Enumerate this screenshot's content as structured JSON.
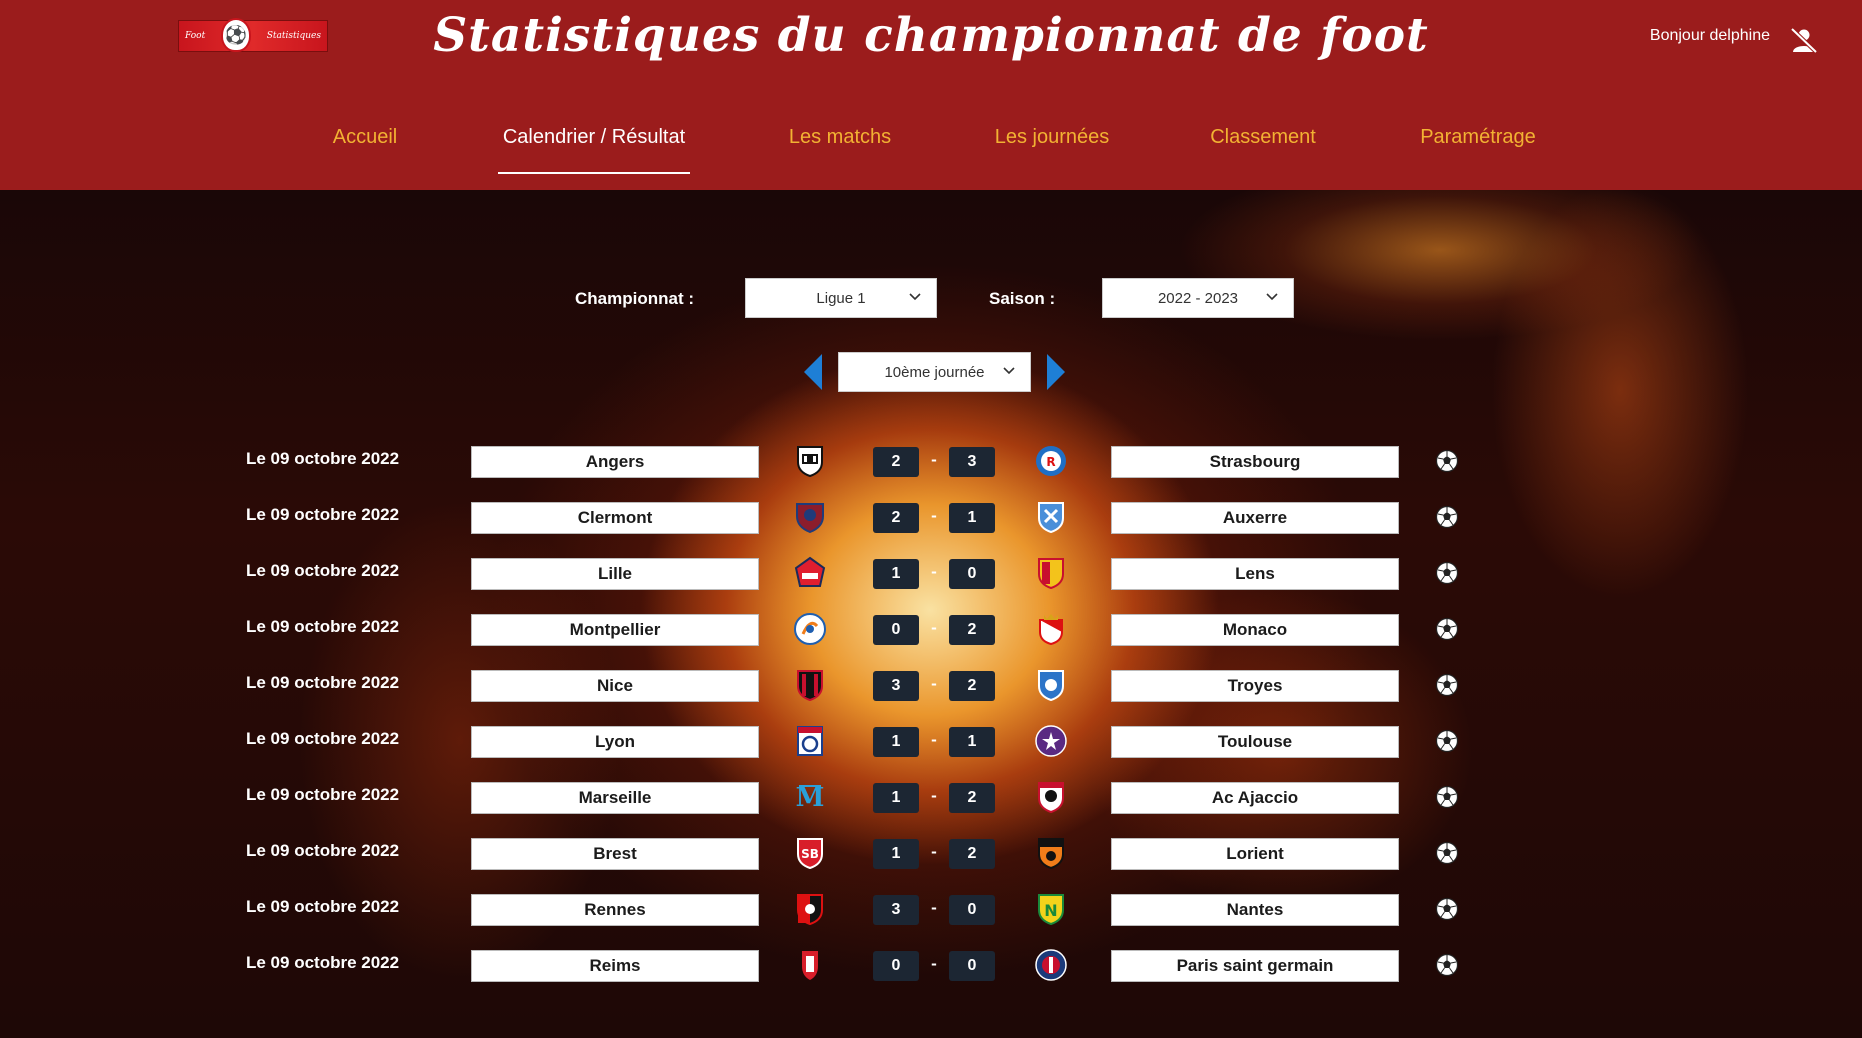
{
  "header": {
    "logo_left": "Foot",
    "logo_right": "Statistiques",
    "title": "Statistiques du championnat de foot",
    "greeting": "Bonjour delphine"
  },
  "nav": {
    "items": [
      {
        "label": "Accueil",
        "active": false
      },
      {
        "label": "Calendrier / Résultat",
        "active": true
      },
      {
        "label": "Les matchs",
        "active": false
      },
      {
        "label": "Les journées",
        "active": false
      },
      {
        "label": "Classement",
        "active": false
      },
      {
        "label": "Paramétrage",
        "active": false
      }
    ]
  },
  "filters": {
    "championnat_label": "Championnat :",
    "championnat_value": "Ligue 1",
    "saison_label": "Saison :",
    "saison_value": "2022 - 2023",
    "journee_value": "10ème journée"
  },
  "colors": {
    "header_bg": "#9b1c1c",
    "nav_inactive": "#f2b233",
    "nav_active": "#ffffff",
    "score_bg": "#1c2633",
    "arrow": "#1e7fd6"
  },
  "matches": [
    {
      "date": "Le 09 octobre 2022",
      "home": "Angers",
      "home_score": "2",
      "away_score": "3",
      "away": "Strasbourg",
      "home_crest": "angers-crest",
      "away_crest": "strasbourg-crest"
    },
    {
      "date": "Le 09 octobre 2022",
      "home": "Clermont",
      "home_score": "2",
      "away_score": "1",
      "away": "Auxerre",
      "home_crest": "clermont-crest",
      "away_crest": "auxerre-crest"
    },
    {
      "date": "Le 09 octobre 2022",
      "home": "Lille",
      "home_score": "1",
      "away_score": "0",
      "away": "Lens",
      "home_crest": "lille-crest",
      "away_crest": "lens-crest"
    },
    {
      "date": "Le 09 octobre 2022",
      "home": "Montpellier",
      "home_score": "0",
      "away_score": "2",
      "away": "Monaco",
      "home_crest": "montpellier-crest",
      "away_crest": "monaco-crest"
    },
    {
      "date": "Le 09 octobre 2022",
      "home": "Nice",
      "home_score": "3",
      "away_score": "2",
      "away": "Troyes",
      "home_crest": "nice-crest",
      "away_crest": "troyes-crest"
    },
    {
      "date": "Le 09 octobre 2022",
      "home": "Lyon",
      "home_score": "1",
      "away_score": "1",
      "away": "Toulouse",
      "home_crest": "lyon-crest",
      "away_crest": "toulouse-crest"
    },
    {
      "date": "Le 09 octobre 2022",
      "home": "Marseille",
      "home_score": "1",
      "away_score": "2",
      "away": "Ac Ajaccio",
      "home_crest": "marseille-crest",
      "away_crest": "ajaccio-crest"
    },
    {
      "date": "Le 09 octobre 2022",
      "home": "Brest",
      "home_score": "1",
      "away_score": "2",
      "away": "Lorient",
      "home_crest": "brest-crest",
      "away_crest": "lorient-crest"
    },
    {
      "date": "Le 09 octobre 2022",
      "home": "Rennes",
      "home_score": "3",
      "away_score": "0",
      "away": "Nantes",
      "home_crest": "rennes-crest",
      "away_crest": "nantes-crest"
    },
    {
      "date": "Le 09 octobre 2022",
      "home": "Reims",
      "home_score": "0",
      "away_score": "0",
      "away": "Paris saint germain",
      "home_crest": "reims-crest",
      "away_crest": "psg-crest"
    }
  ]
}
